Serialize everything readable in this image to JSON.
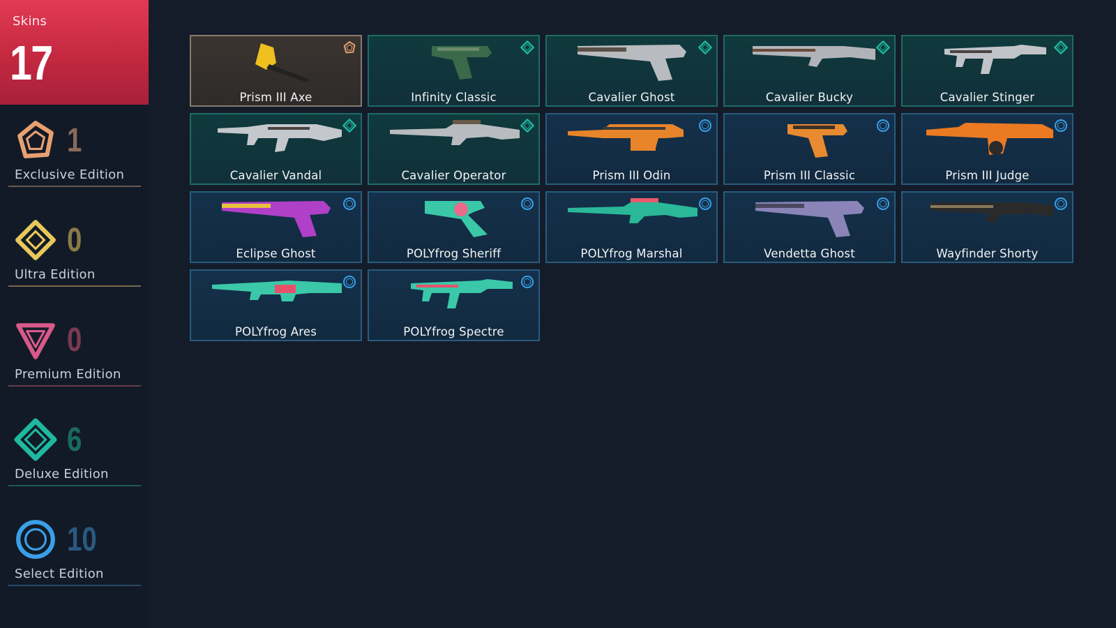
{
  "sidebar": {
    "skins_label": "Skins",
    "skins_count": "17",
    "editions": [
      {
        "name": "Exclusive Edition",
        "count": "1",
        "icon": "exclusive-edition-icon",
        "color": "#e8a070",
        "count_color": "#8a6a58",
        "line_color": "#6a5a52"
      },
      {
        "name": "Ultra Edition",
        "count": "0",
        "icon": "ultra-edition-icon",
        "color": "#e8c85a",
        "count_color": "#8a7a48",
        "line_color": "#7a6a48"
      },
      {
        "name": "Premium Edition",
        "count": "0",
        "icon": "premium-edition-icon",
        "color": "#d85a8a",
        "count_color": "#7a3a52",
        "line_color": "#6a3a4a"
      },
      {
        "name": "Deluxe Edition",
        "count": "6",
        "icon": "deluxe-edition-icon",
        "color": "#1fb8a0",
        "count_color": "#1a6a62",
        "line_color": "#1a5a58"
      },
      {
        "name": "Select Edition",
        "count": "10",
        "icon": "select-edition-icon",
        "color": "#3aa0e8",
        "count_color": "#2a5a80",
        "line_color": "#2a4a68"
      }
    ]
  },
  "skins": [
    {
      "name": "Prism III Axe",
      "tier": "exclusive",
      "weapon": "melee-axe"
    },
    {
      "name": "Infinity Classic",
      "tier": "deluxe",
      "weapon": "pistol"
    },
    {
      "name": "Cavalier Ghost",
      "tier": "deluxe",
      "weapon": "pistol-long"
    },
    {
      "name": "Cavalier Bucky",
      "tier": "deluxe",
      "weapon": "shotgun"
    },
    {
      "name": "Cavalier Stinger",
      "tier": "deluxe",
      "weapon": "smg"
    },
    {
      "name": "Cavalier Vandal",
      "tier": "deluxe",
      "weapon": "rifle"
    },
    {
      "name": "Cavalier Operator",
      "tier": "deluxe",
      "weapon": "sniper"
    },
    {
      "name": "Prism III Odin",
      "tier": "select",
      "weapon": "heavy"
    },
    {
      "name": "Prism III Classic",
      "tier": "select",
      "weapon": "pistol"
    },
    {
      "name": "Prism III Judge",
      "tier": "select",
      "weapon": "heavy-shotgun"
    },
    {
      "name": "Eclipse Ghost",
      "tier": "select",
      "weapon": "pistol-long"
    },
    {
      "name": "POLYfrog Sheriff",
      "tier": "select",
      "weapon": "revolver"
    },
    {
      "name": "POLYfrog Marshal",
      "tier": "select",
      "weapon": "sniper"
    },
    {
      "name": "Vendetta Ghost",
      "tier": "select",
      "weapon": "pistol-long"
    },
    {
      "name": "Wayfinder Shorty",
      "tier": "select",
      "weapon": "shotgun-short"
    },
    {
      "name": "POLYfrog Ares",
      "tier": "select",
      "weapon": "lmg"
    },
    {
      "name": "POLYfrog Spectre",
      "tier": "select",
      "weapon": "smg"
    }
  ],
  "weapon_colors": {
    "Prism III Axe": [
      "#f0c020",
      "#222222"
    ],
    "Infinity Classic": [
      "#3a6a4a",
      "#6a8a6a"
    ],
    "Cavalier Ghost": [
      "#b8bcc0",
      "#5a5048"
    ],
    "Cavalier Bucky": [
      "#b0b4b8",
      "#6a4a3a"
    ],
    "Cavalier Stinger": [
      "#c0c4c8",
      "#4a4440"
    ],
    "Cavalier Vandal": [
      "#c4c8cc",
      "#4a4440"
    ],
    "Cavalier Operator": [
      "#b8bcc0",
      "#6a5a4a"
    ],
    "Prism III Odin": [
      "#e8842a",
      "#3a3a3a"
    ],
    "Prism III Classic": [
      "#e88a30",
      "#3a3028"
    ],
    "Prism III Judge": [
      "#ec7a22",
      "#2a2a2a"
    ],
    "Eclipse Ghost": [
      "#b040c8",
      "#e8c040"
    ],
    "POLYfrog Sheriff": [
      "#3ac8a8",
      "#e86a8a"
    ],
    "POLYfrog Marshal": [
      "#2ab898",
      "#e85a6a"
    ],
    "Vendetta Ghost": [
      "#8a84b8",
      "#4a4860"
    ],
    "Wayfinder Shorty": [
      "#2a2a2a",
      "#8a7a5a"
    ],
    "POLYfrog Ares": [
      "#3ac8a8",
      "#e8506a"
    ],
    "POLYfrog Spectre": [
      "#3ac8a8",
      "#e8506a"
    ]
  }
}
